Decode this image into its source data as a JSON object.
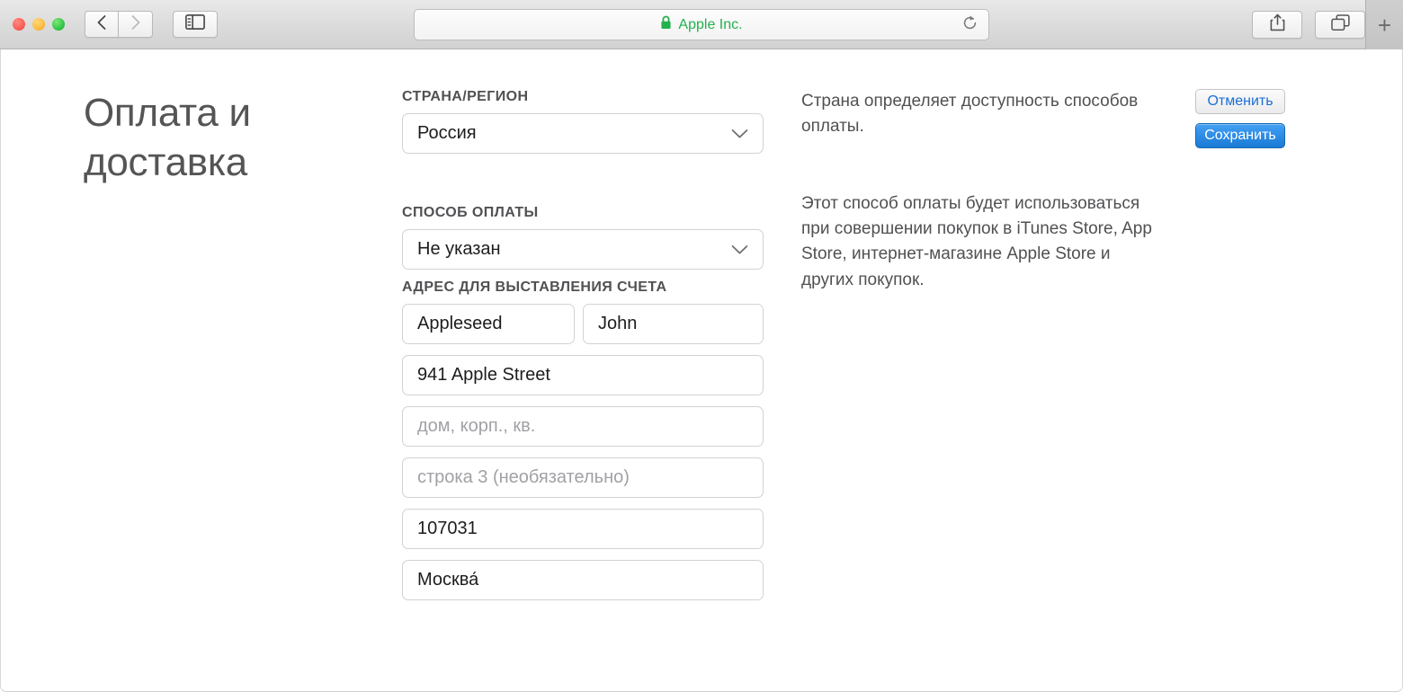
{
  "browser": {
    "traffic_lights": [
      "close",
      "minimize",
      "zoom"
    ],
    "back_label": "Back",
    "forward_label": "Forward",
    "sidebar_label": "Show Sidebar",
    "address": {
      "secure_label": "Apple Inc.",
      "secure_color": "#23b14d",
      "reload_label": "Reload"
    },
    "share_label": "Share",
    "tabs_label": "Show Tab Overview",
    "new_tab_label": "+"
  },
  "page": {
    "title": "Оплата и доставка",
    "form": {
      "country_label": "СТРАНА/РЕГИОН",
      "country_value": "Россия",
      "payment_label": "СПОСОБ ОПЛАТЫ",
      "payment_value": "Не указан",
      "billing_label": "АДРЕС ДЛЯ ВЫСТАВЛЕНИЯ СЧЕТА",
      "last_name": "Appleseed",
      "first_name": "John",
      "street": "941 Apple Street",
      "apartment_placeholder": "дом, корп., кв.",
      "line3_placeholder": "строка 3 (необязательно)",
      "postal_code": "107031",
      "city": "Москва́"
    },
    "help": {
      "country_note": "Страна определяет доступность способов оплаты.",
      "payment_note": "Этот способ оплаты будет использоваться при совершении покупок в iTunes Store, App Store, интернет-магазине Apple Store и других покупок."
    },
    "actions": {
      "cancel_label": "Отменить",
      "save_label": "Сохранить",
      "save_color": "#2f8fe8",
      "cancel_text_color": "#1a6fd4"
    }
  }
}
